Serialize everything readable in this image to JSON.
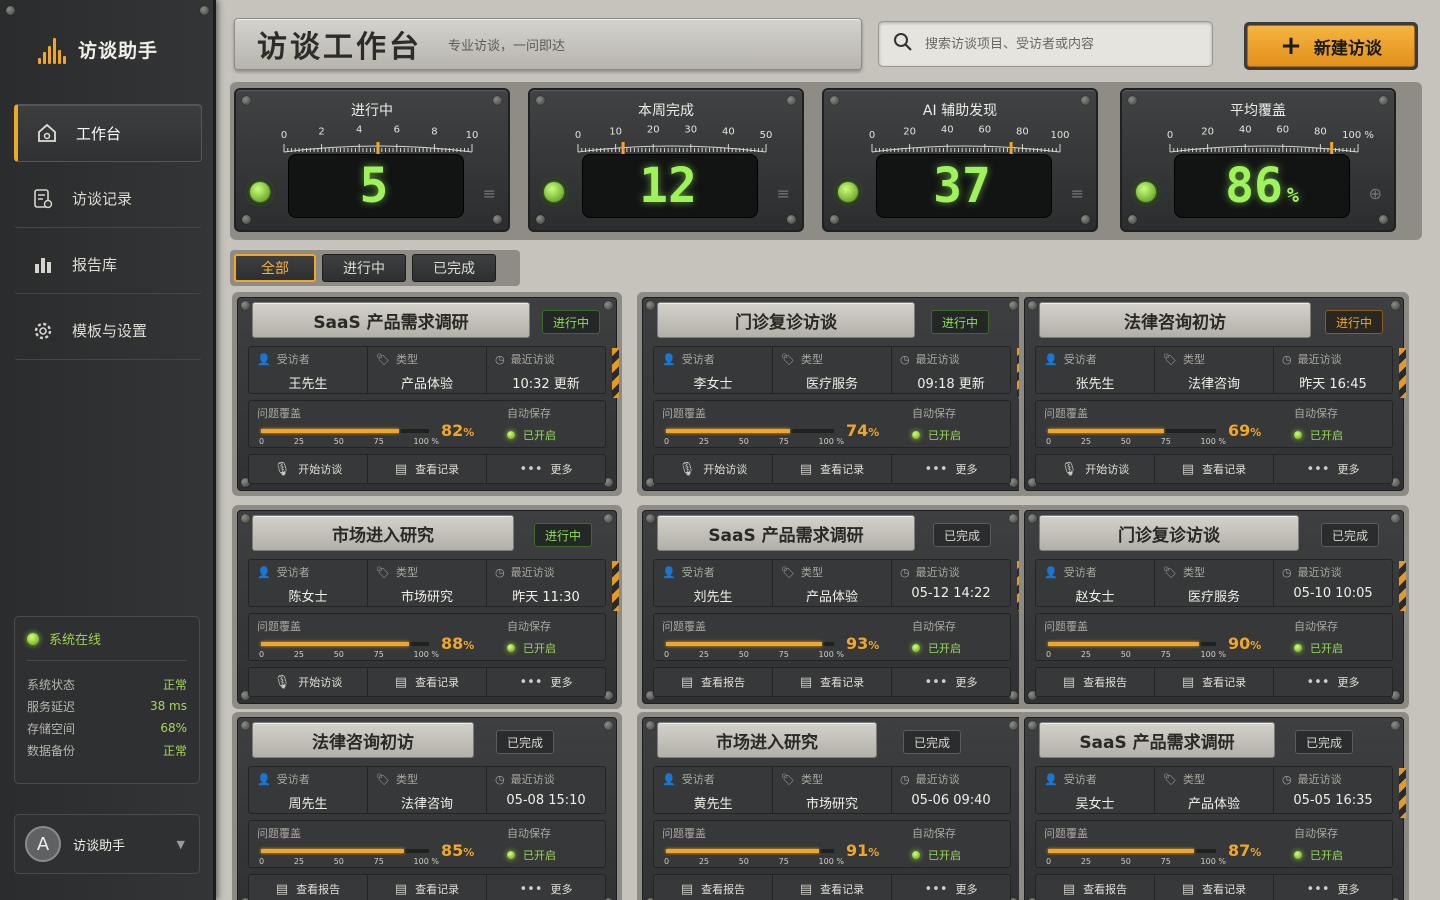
{
  "app": {
    "name": "访谈助手"
  },
  "sidebar": {
    "items": [
      {
        "label": "工作台",
        "icon": "home-icon",
        "active": true
      },
      {
        "label": "访谈记录",
        "icon": "record-icon",
        "active": false
      },
      {
        "label": "报告库",
        "icon": "chart-icon",
        "active": false
      },
      {
        "label": "模板与设置",
        "icon": "gear-icon",
        "active": false
      }
    ],
    "status": {
      "title": "系统在线",
      "rows": [
        {
          "label": "系统状态",
          "value": "正常"
        },
        {
          "label": "服务延迟",
          "value": "38 ms"
        },
        {
          "label": "存储空间",
          "value": "68%"
        },
        {
          "label": "数据备份",
          "value": "正常"
        }
      ]
    },
    "user": {
      "avatar": "A",
      "name": "访谈助手"
    }
  },
  "header": {
    "title": "访谈工作台",
    "subtitle": "专业访谈，一问即达",
    "search_placeholder": "搜索访谈项目、受访者或内容",
    "new_button": "新建访谈"
  },
  "gauges": [
    {
      "title": "进行中",
      "value": "5",
      "unit": "",
      "ticks": [
        "0",
        "2",
        "4",
        "6",
        "8",
        "10"
      ],
      "level": 0.5
    },
    {
      "title": "本周完成",
      "value": "12",
      "unit": "",
      "ticks": [
        "0",
        "10",
        "20",
        "30",
        "40",
        "50"
      ],
      "level": 0.24
    },
    {
      "title": "AI 辅助发现",
      "value": "37",
      "unit": "",
      "ticks": [
        "0",
        "20",
        "40",
        "60",
        "80",
        "100"
      ],
      "level": 0.74
    },
    {
      "title": "平均覆盖",
      "value": "86",
      "unit": "%",
      "ticks": [
        "0",
        "20",
        "40",
        "60",
        "80",
        "100 %"
      ],
      "level": 0.86
    }
  ],
  "filters": [
    {
      "label": "全部",
      "active": true
    },
    {
      "label": "进行中",
      "active": false
    },
    {
      "label": "已完成",
      "active": false
    }
  ],
  "labels": {
    "interviewee": "受访者",
    "type": "类型",
    "recent": "最近访谈",
    "coverage": "问题覆盖",
    "autosave": "自动保存",
    "autosave_on": "已开启",
    "ticks": [
      "0",
      "25",
      "50",
      "75",
      "100 %"
    ],
    "more": "更多"
  },
  "cards": [
    {
      "title": "SaaS 产品需求调研",
      "status": "进行中",
      "status_style": "doing",
      "person": "王先生",
      "type": "产品体验",
      "recent": "10:32 更新",
      "coverage": 82,
      "actions": [
        "开始访谈",
        "查看记录",
        "更多"
      ]
    },
    {
      "title": "门诊复诊访谈",
      "status": "进行中",
      "status_style": "doing",
      "person": "李女士",
      "type": "医疗服务",
      "recent": "09:18 更新",
      "coverage": 74,
      "actions": [
        "开始访谈",
        "查看记录",
        "更多"
      ]
    },
    {
      "title": "法律咨询初访",
      "status": "进行中",
      "status_style": "orange",
      "person": "张先生",
      "type": "法律咨询",
      "recent": "昨天 16:45",
      "coverage": 69,
      "actions": [
        "开始访谈",
        "查看记录",
        "更多"
      ]
    },
    {
      "title": "市场进入研究",
      "status": "进行中",
      "status_style": "doing",
      "person": "陈女士",
      "type": "市场研究",
      "recent": "昨天 11:30",
      "coverage": 88,
      "actions": [
        "开始访谈",
        "查看记录",
        "更多"
      ]
    },
    {
      "title": "SaaS 产品需求调研",
      "status": "已完成",
      "status_style": "done",
      "person": "刘先生",
      "type": "产品体验",
      "recent": "05-12 14:22",
      "coverage": 93,
      "actions": [
        "查看报告",
        "查看记录",
        "更多"
      ]
    },
    {
      "title": "门诊复诊访谈",
      "status": "已完成",
      "status_style": "done",
      "person": "赵女士",
      "type": "医疗服务",
      "recent": "05-10 10:05",
      "coverage": 90,
      "actions": [
        "查看报告",
        "查看记录",
        "更多"
      ]
    },
    {
      "title": "法律咨询初访",
      "status": "已完成",
      "status_style": "done",
      "person": "周先生",
      "type": "法律咨询",
      "recent": "05-08 15:10",
      "coverage": 85,
      "actions": [
        "查看报告",
        "查看记录",
        "更多"
      ]
    },
    {
      "title": "市场进入研究",
      "status": "已完成",
      "status_style": "done",
      "person": "黄先生",
      "type": "市场研究",
      "recent": "05-06 09:40",
      "coverage": 91,
      "actions": [
        "查看报告",
        "查看记录",
        "更多"
      ]
    },
    {
      "title": "SaaS 产品需求调研",
      "status": "已完成",
      "status_style": "done",
      "person": "吴女士",
      "type": "产品体验",
      "recent": "05-05 16:35",
      "coverage": 87,
      "actions": [
        "查看报告",
        "查看记录",
        "更多"
      ]
    }
  ]
}
